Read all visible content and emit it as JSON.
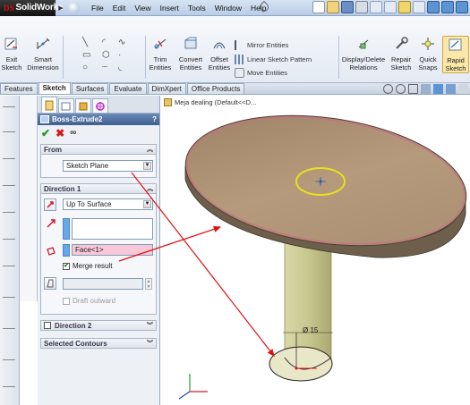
{
  "app": {
    "name": "SolidWorks",
    "brand_prefix": "DS"
  },
  "menu": [
    "File",
    "Edit",
    "View",
    "Insert",
    "Tools",
    "Window",
    "Help"
  ],
  "commands": {
    "exit_sketch": "Exit\nSketch",
    "smart_dimension": "Smart\nDimension",
    "trim_entities": "Trim\nEntities",
    "convert_entities": "Convert\nEntities",
    "offset_entities": "Offset\nEntities",
    "mirror_entities": "Mirror Entities",
    "linear_sketch_pattern": "Linear Sketch Pattern",
    "move_entities": "Move Entities",
    "display_delete_relations": "Display/Delete\nRelations",
    "repair_sketch": "Repair\nSketch",
    "quick_snaps": "Quick\nSnaps",
    "rapid_sketch": "Rapid\nSketch"
  },
  "tabs": [
    "Features",
    "Sketch",
    "Surfaces",
    "Evaluate",
    "DimXpert",
    "Office Products"
  ],
  "active_tab": "Sketch",
  "feature_tree": {
    "root": "Meja dealing  (Default<<D..."
  },
  "property_manager": {
    "title": "Boss-Extrude2",
    "help": "?",
    "from_label": "From",
    "from_value": "Sketch Plane",
    "direction1_label": "Direction 1",
    "direction1_type": "Up To Surface",
    "face_field": "Face<1>",
    "merge_result": "Merge result",
    "draft_outward": "Draft outward",
    "direction2_label": "Direction 2",
    "selected_contours": "Selected Contours"
  },
  "dimension": {
    "text": "Ø 15"
  },
  "colors": {
    "tabletop": "#b09476",
    "leg": "#cdcd96",
    "arrow": "#e01010",
    "highlight": "#e7e21a",
    "edge_pink": "#d06a8a"
  }
}
